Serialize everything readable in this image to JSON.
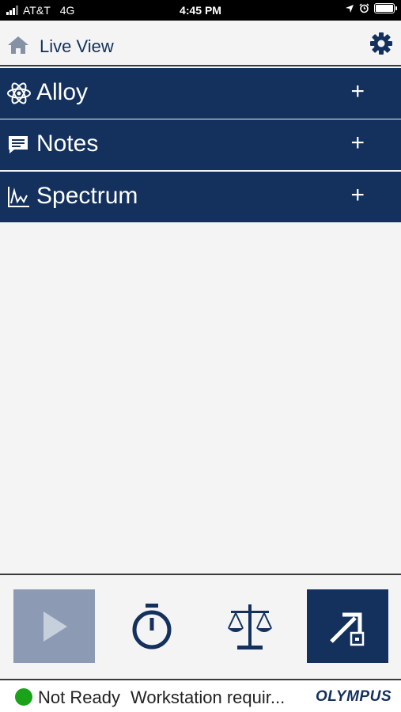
{
  "status_bar": {
    "carrier": "AT&T",
    "network": "4G",
    "time": "4:45 PM"
  },
  "header": {
    "title": "Live View",
    "home_icon": "home-icon",
    "settings_icon": "gear-icon"
  },
  "sections": [
    {
      "label": "Alloy",
      "icon": "atom-icon",
      "expand": "+"
    },
    {
      "label": "Notes",
      "icon": "note-icon",
      "expand": "+"
    },
    {
      "label": "Spectrum",
      "icon": "spectrum-icon",
      "expand": "+"
    }
  ],
  "toolbar": {
    "buttons": [
      "play-icon",
      "stopwatch-icon",
      "scale-icon",
      "export-icon"
    ]
  },
  "footer": {
    "status": "Not Ready",
    "message": "Workstation requir...",
    "brand": "OLYMPUS",
    "status_color": "#1aa31a"
  },
  "colors": {
    "primary": "#13315c",
    "disabled": "#8c9bb3",
    "background": "#f4f4f5"
  }
}
